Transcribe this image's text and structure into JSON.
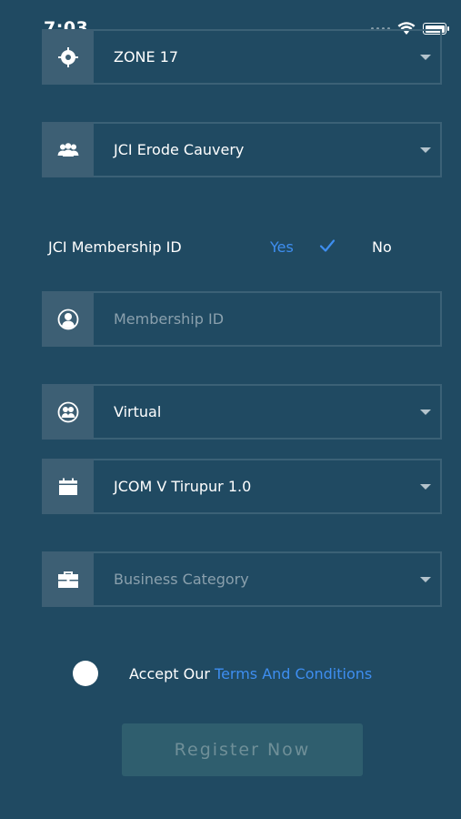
{
  "status_bar": {
    "time": "7:03"
  },
  "form": {
    "zone": {
      "value": "ZONE 17",
      "icon": "crosshair-icon"
    },
    "chapter": {
      "value": "JCI Erode Cauvery",
      "icon": "group-icon"
    },
    "membership": {
      "label": "JCI Membership ID",
      "yes": "Yes",
      "no": "No",
      "selected": "Yes"
    },
    "membership_id": {
      "placeholder": "Membership ID",
      "icon": "user-icon"
    },
    "event_type": {
      "value": "Virtual",
      "icon": "users-circle-icon"
    },
    "event": {
      "value": "JCOM V Tirupur 1.0",
      "icon": "calendar-icon"
    },
    "business_category": {
      "placeholder": "Business Category",
      "icon": "briefcase-icon"
    },
    "terms": {
      "prefix": "Accept Our ",
      "link": "Terms And Conditions"
    },
    "register_label": "Register Now"
  },
  "colors": {
    "background": "#204a62",
    "accent": "#3e8ef0",
    "button": "#2f5e6e"
  }
}
